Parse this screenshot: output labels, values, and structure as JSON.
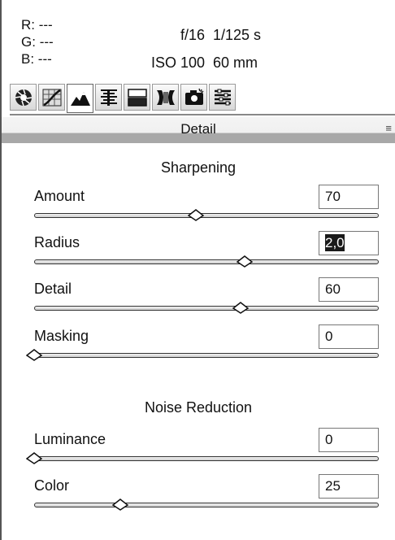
{
  "info": {
    "rgb": [
      {
        "label": "R:",
        "value": "---"
      },
      {
        "label": "G:",
        "value": "---"
      },
      {
        "label": "B:",
        "value": "---"
      }
    ],
    "aperture": "f/16",
    "shutter": "1/125 s",
    "iso": "ISO 100",
    "focal_length": "60 mm"
  },
  "tabs": [
    {
      "name": "basic-tab",
      "icon": "aperture-icon"
    },
    {
      "name": "tone-curve-tab",
      "icon": "tone-curve-icon"
    },
    {
      "name": "detail-tab",
      "icon": "mountains-icon",
      "active": true
    },
    {
      "name": "hsl-tab",
      "icon": "hsl-bars-icon"
    },
    {
      "name": "split-toning-tab",
      "icon": "split-toning-icon"
    },
    {
      "name": "lens-corrections-tab",
      "icon": "lens-icon"
    },
    {
      "name": "effects-tab",
      "icon": "fx-icon"
    },
    {
      "name": "presets-tab",
      "icon": "presets-icon"
    }
  ],
  "section": {
    "title": "Detail",
    "menu_icon": "panel-menu-icon"
  },
  "sharpening": {
    "title": "Sharpening",
    "sliders": [
      {
        "label": "Amount",
        "value": "70",
        "position": 0.47
      },
      {
        "label": "Radius",
        "value": "2,0",
        "position": 0.61,
        "selected": true
      },
      {
        "label": "Detail",
        "value": "60",
        "position": 0.6
      },
      {
        "label": "Masking",
        "value": "0",
        "position": 0.0
      }
    ]
  },
  "noise_reduction": {
    "title": "Noise Reduction",
    "sliders": [
      {
        "label": "Luminance",
        "value": "0",
        "position": 0.0
      },
      {
        "label": "Color",
        "value": "25",
        "position": 0.25
      }
    ]
  }
}
